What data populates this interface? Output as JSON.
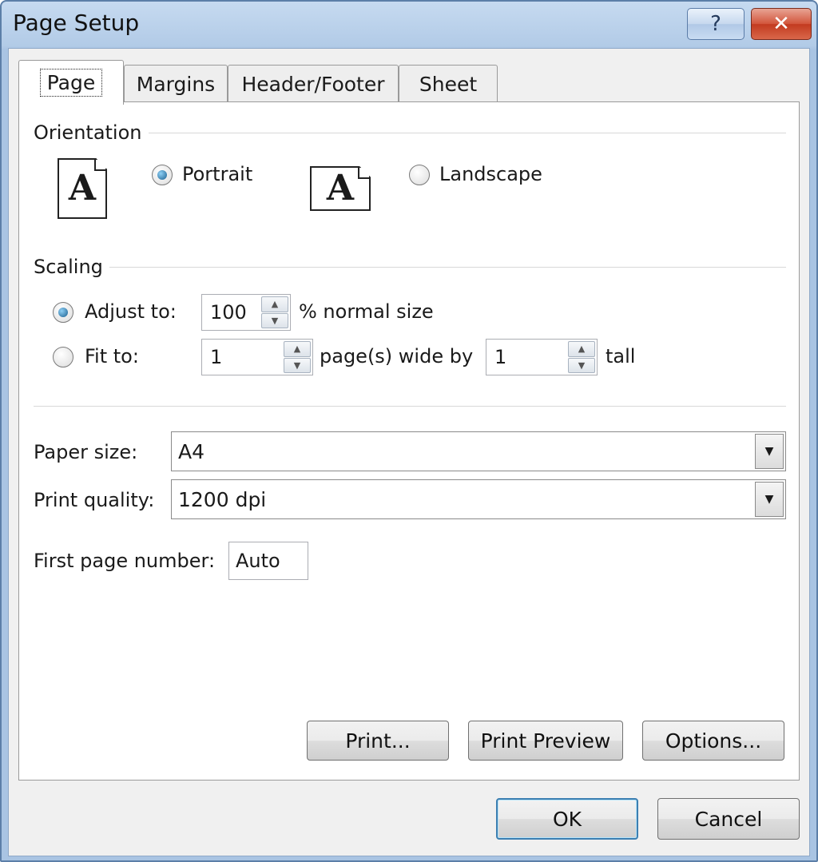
{
  "window": {
    "title": "Page Setup",
    "help_glyph": "?",
    "close_glyph": "✕"
  },
  "tabs": [
    {
      "label": "Page",
      "active": true
    },
    {
      "label": "Margins",
      "active": false
    },
    {
      "label": "Header/Footer",
      "active": false
    },
    {
      "label": "Sheet",
      "active": false
    }
  ],
  "orientation": {
    "label": "Orientation",
    "icon_letter": "A",
    "portrait_label": "Portrait",
    "landscape_label": "Landscape",
    "selected": "portrait"
  },
  "scaling": {
    "label": "Scaling",
    "adjust_to_label": "Adjust to:",
    "adjust_value": "100",
    "adjust_suffix": "% normal size",
    "fit_to_label": "Fit to:",
    "fit_wide_value": "1",
    "fit_wide_suffix": "page(s) wide by",
    "fit_tall_value": "1",
    "fit_tall_suffix": "tall",
    "selected": "adjust"
  },
  "paper_size": {
    "label": "Paper size:",
    "value": "A4"
  },
  "print_quality": {
    "label": "Print quality:",
    "value": "1200 dpi"
  },
  "first_page": {
    "label": "First page number:",
    "value": "Auto"
  },
  "panel_buttons": {
    "print": "Print...",
    "preview": "Print Preview",
    "options": "Options..."
  },
  "footer_buttons": {
    "ok": "OK",
    "cancel": "Cancel"
  },
  "icons": {
    "spin_up": "▲",
    "spin_down": "▼",
    "combo_arrow": "▼"
  }
}
